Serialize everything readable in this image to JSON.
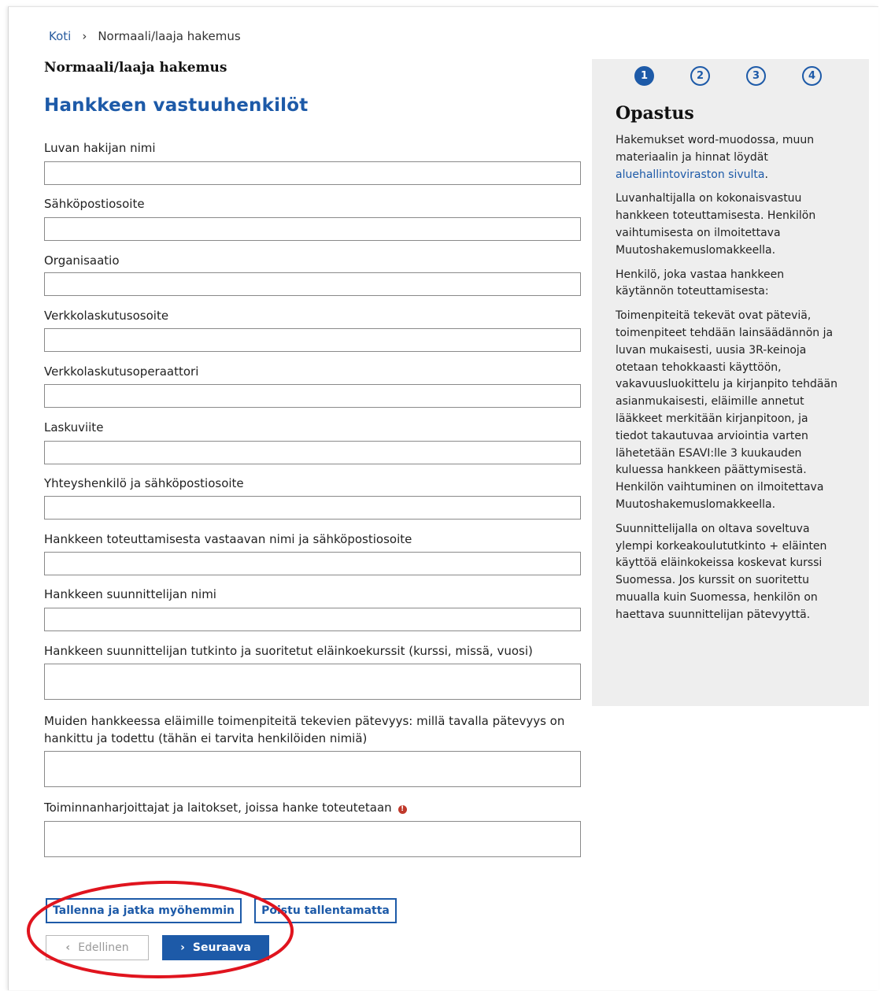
{
  "breadcrumb": {
    "home": "Koti",
    "separator": "›",
    "current": "Normaali/laaja hakemus"
  },
  "page_title": "Normaali/laaja hakemus",
  "section_title": "Hankkeen vastuuhenkilöt",
  "fields": [
    {
      "label": "Luvan hakijan nimi",
      "value": ""
    },
    {
      "label": "Sähköpostiosoite",
      "value": ""
    },
    {
      "label": "Organisaatio",
      "value": ""
    },
    {
      "label": "Verkkolaskutusosoite",
      "value": ""
    },
    {
      "label": "Verkkolaskutusoperaattori",
      "value": ""
    },
    {
      "label": "Laskuviite",
      "value": ""
    },
    {
      "label": "Yhteyshenkilö ja sähköpostiosoite",
      "value": ""
    },
    {
      "label": "Hankkeen toteuttamisesta vastaavan nimi ja sähköpostiosoite",
      "value": ""
    },
    {
      "label": "Hankkeen suunnittelijan nimi",
      "value": ""
    },
    {
      "label": "Hankkeen suunnittelijan tutkinto ja suoritetut eläinkoekurssit (kurssi, missä, vuosi)",
      "value": ""
    },
    {
      "label": "Muiden hankkeessa eläimille toimenpiteitä tekevien pätevyys: millä tavalla pätevyys on hankittu ja todettu (tähän ei tarvita henkilöiden nimiä)",
      "value": ""
    },
    {
      "label": "Toiminnanharjoittajat ja laitokset, joissa hanke toteutetaan",
      "value": ""
    }
  ],
  "steps": [
    "1",
    "2",
    "3",
    "4"
  ],
  "active_step": 1,
  "guide": {
    "title": "Opastus",
    "p1_text": "Hakemukset word-muodossa, muun materiaalin ja hinnat löydät ",
    "p1_link": "aluehallintoviraston sivulta",
    "p1_end": ".",
    "p2": "Luvanhaltijalla on kokonaisvastuu hankkeen toteuttamisesta. Henkilön vaihtumisesta on ilmoitettava Muutoshakemuslomakkeella.",
    "p3": "Henkilö, joka vastaa hankkeen käytännön toteuttamisesta:",
    "p4": "Toimenpiteitä tekevät ovat päteviä, toimenpiteet tehdään lainsäädännön ja luvan mukaisesti, uusia 3R-keinoja otetaan tehokkaasti käyttöön, vakavuusluokittelu ja kirjanpito tehdään asianmukaisesti, eläimille annetut lääkkeet merkitään kirjanpitoon, ja tiedot takautuvaa arviointia varten lähetetään ESAVI:lle 3 kuukauden kuluessa hankkeen päättymisestä. Henkilön vaihtuminen on ilmoitettava Muutoshakemuslomakkeella.",
    "p5": "Suunnittelijalla on oltava soveltuva ylempi korkeakoulututkinto + eläinten käyttöä eläinkokeissa koskevat kurssi Suomessa. Jos kurssit on suoritettu muualla kuin Suomessa, henkilön on haettava suunnittelijan pätevyyttä."
  },
  "buttons": {
    "save_later": "Tallenna ja jatka myöhemmin",
    "exit_unsaved": "Poistu tallentamatta",
    "previous": "Edellinen",
    "next": "Seuraava"
  },
  "colors": {
    "accent": "#1d5aa8",
    "sidebar_bg": "#eeeeee",
    "annotation": "#e0141e",
    "info_icon": "#c0392b"
  },
  "icons": {
    "breadcrumb_separator": "chevron-right-icon",
    "previous": "chevron-left-icon",
    "next": "chevron-right-icon",
    "info": "info-icon"
  }
}
